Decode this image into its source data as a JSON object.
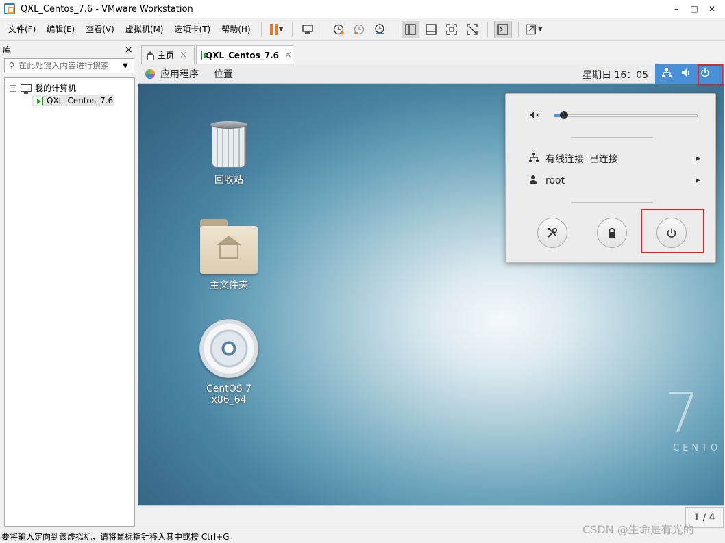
{
  "window": {
    "title": "QXL_Centos_7.6 - VMware Workstation",
    "minimize": "–",
    "maximize": "□",
    "close": "✕"
  },
  "menu": [
    "文件(F)",
    "编辑(E)",
    "查看(V)",
    "虚拟机(M)",
    "选项卡(T)",
    "帮助(H)"
  ],
  "toolbar_icons": [
    "pause-icon",
    "send-ctrl-alt-del-icon",
    "snapshot-icon",
    "revert-snapshot-icon",
    "snapshot-manager-icon",
    "show-library-icon",
    "thumbnail-bar-icon",
    "fit-guest-icon",
    "fullscreen-off-icon",
    "console-view-icon",
    "fullscreen-icon"
  ],
  "library": {
    "title": "库",
    "close": "×",
    "search_placeholder": "在此处键入内容进行搜索",
    "tree_root": "我的计算机",
    "tree_child": "QXL_Centos_7.6",
    "expander": "−"
  },
  "tabs": [
    {
      "label": "主页",
      "close": "×"
    },
    {
      "label": "QXL_Centos_7.6",
      "close": "×"
    }
  ],
  "gnome": {
    "apps": "应用程序",
    "places": "位置",
    "clock": "星期日 16：05",
    "network_icon": "network-icon",
    "volume_icon": "volume-icon",
    "power_icon": "power-icon"
  },
  "desktop": {
    "trash_label": "回收站",
    "home_label": "主文件夹",
    "disc_label": "CentOS 7 x86_64",
    "brand_number": "7",
    "brand_word": "CENTO"
  },
  "popup": {
    "volume_level": 0.07,
    "network_label": "有线连接",
    "network_status": "已连接",
    "user_label": "root",
    "settings_icon": "settings-icon",
    "lock_icon": "lock-icon",
    "power_icon": "power-icon"
  },
  "footer": {
    "page_indicator": "1 / 4"
  },
  "statusbar": {
    "text": "要将输入定向到该虚拟机，请将鼠标指针移入其中或按 Ctrl+G。"
  },
  "watermark": "CSDN @生命是有光的",
  "colors": {
    "accent_blue": "#4a90d9",
    "highlight_red": "#d12a2a",
    "pause_orange": "#f07820"
  }
}
